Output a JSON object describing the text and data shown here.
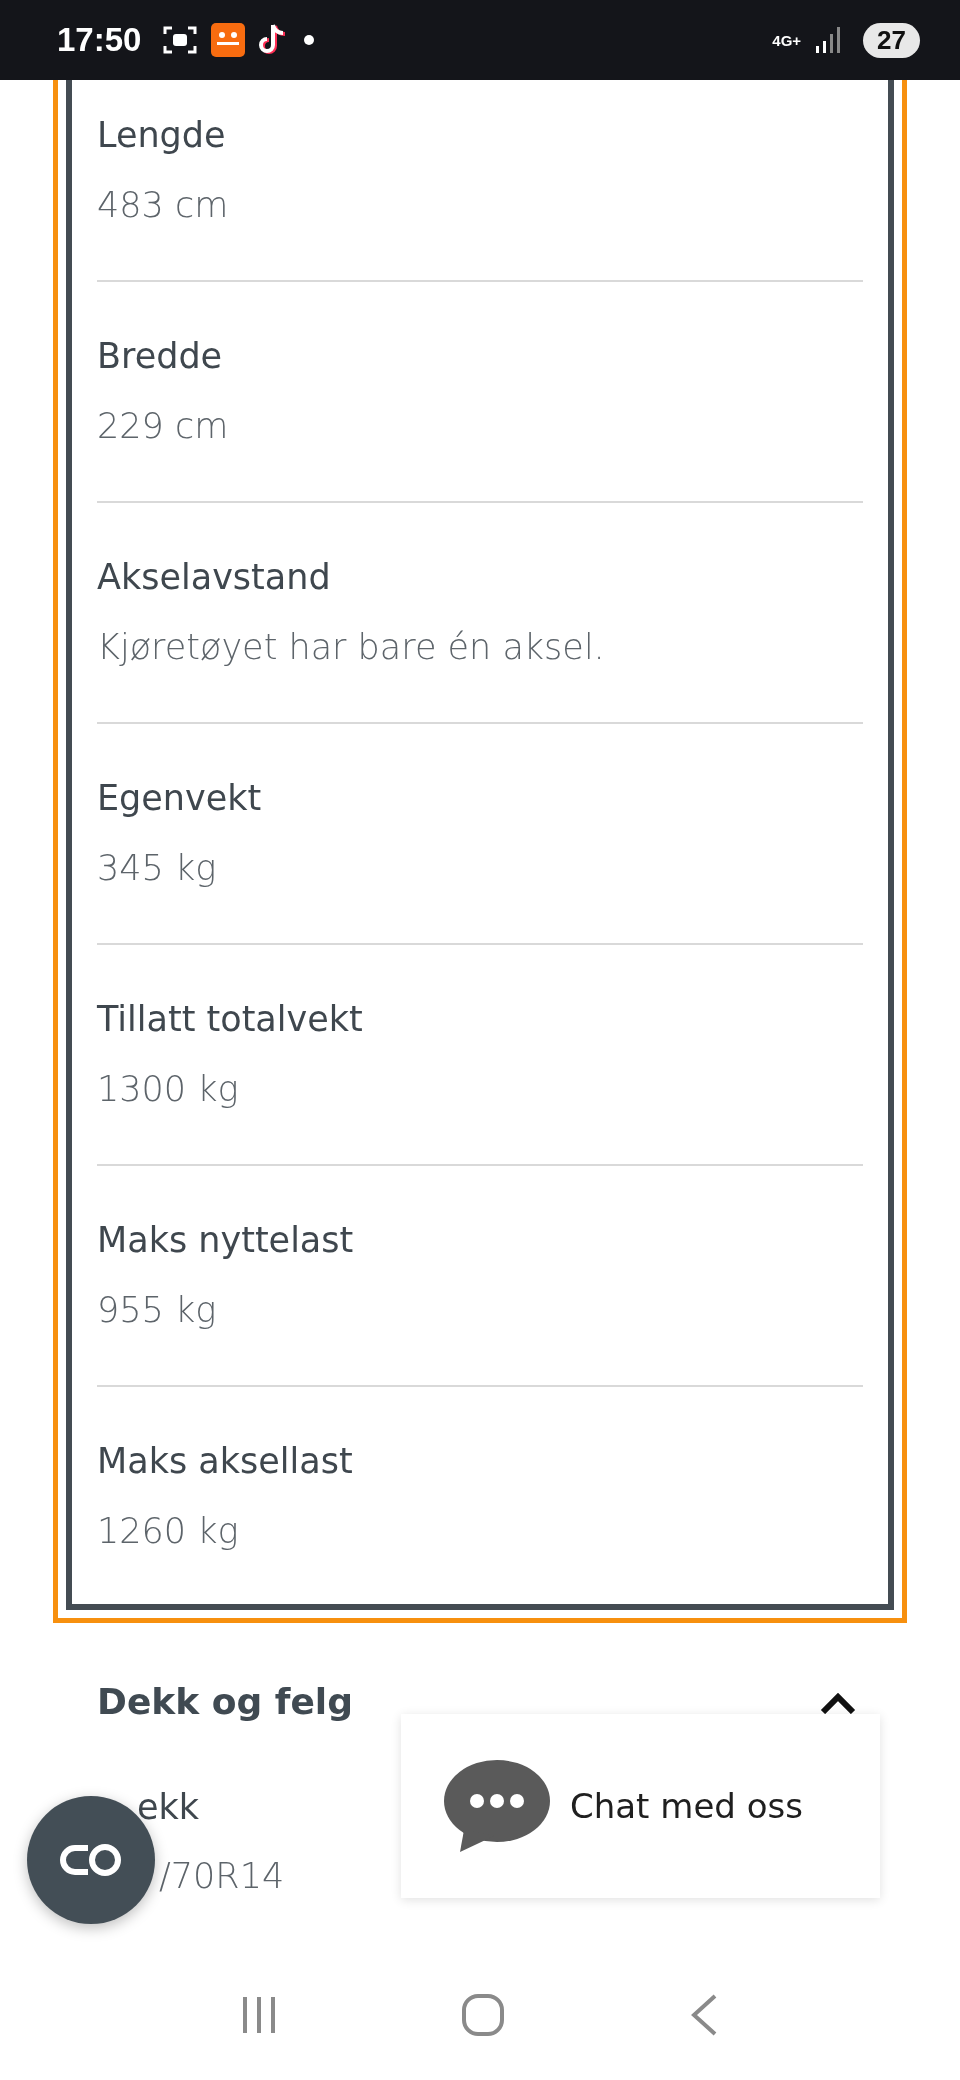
{
  "status_bar": {
    "time": "17:50",
    "network": "4G+",
    "battery": "27"
  },
  "specs": [
    {
      "label": "Lengde",
      "value": "483 cm"
    },
    {
      "label": "Bredde",
      "value": "229 cm"
    },
    {
      "label": "Akselavstand",
      "value": "Kjøretøyet har bare én aksel."
    },
    {
      "label": "Egenvekt",
      "value": "345 kg"
    },
    {
      "label": "Tillatt totalvekt",
      "value": "1300 kg"
    },
    {
      "label": "Maks nyttelast",
      "value": "955 kg"
    },
    {
      "label": "Maks aksellast",
      "value": "1260 kg"
    }
  ],
  "section": {
    "title": "Dekk og felg",
    "expanded": true,
    "items": [
      {
        "label": "ekk",
        "value": "/70R14"
      }
    ]
  },
  "chat_popup": {
    "label": "Chat med oss"
  }
}
